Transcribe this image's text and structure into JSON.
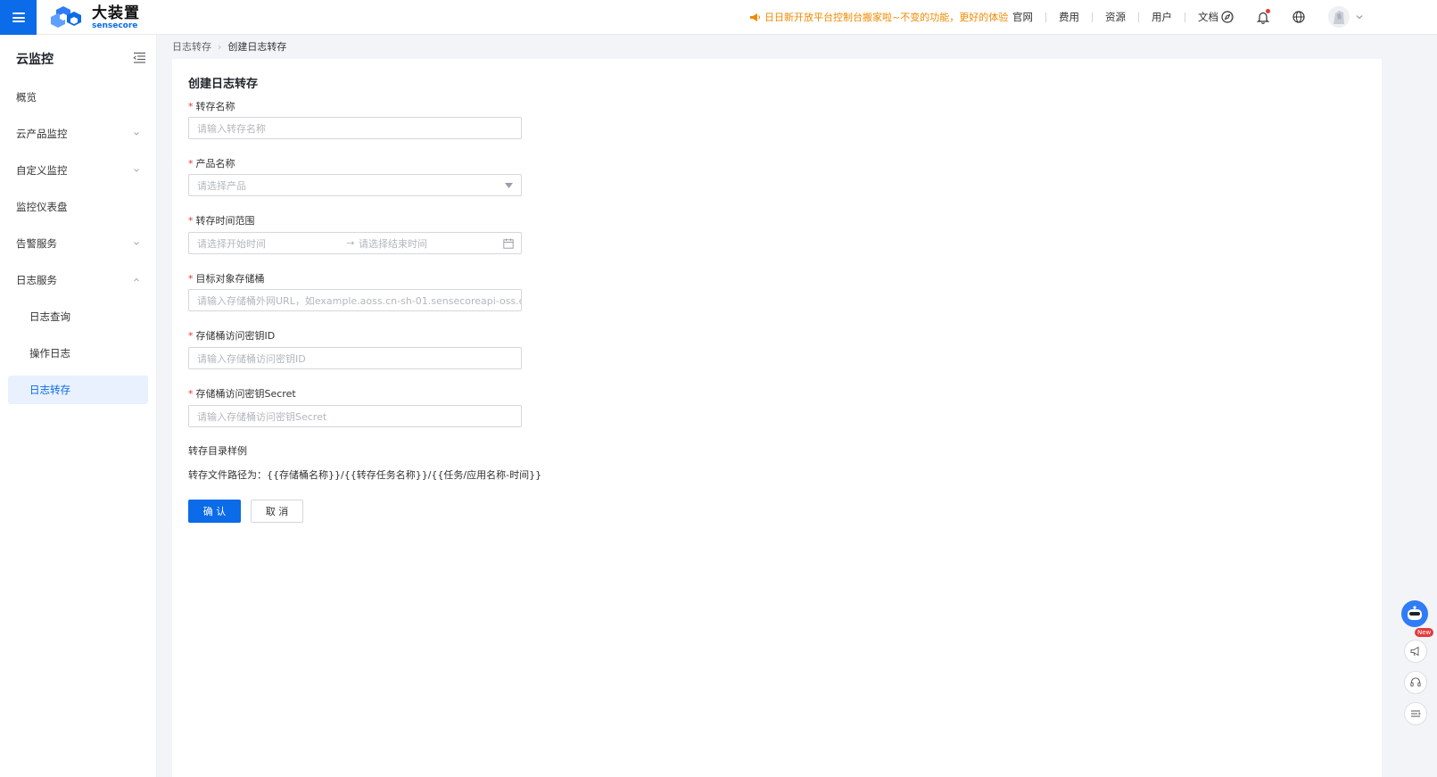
{
  "header": {
    "brand_name": "大装置",
    "brand_sub": "sensecore",
    "notice": "日日新开放平台控制台搬家啦~不变的功能，更好的体验",
    "nav": [
      "官网",
      "费用",
      "资源",
      "用户",
      "文档"
    ],
    "icons": [
      "compass-icon",
      "bell-icon",
      "globe-icon"
    ],
    "accent_color": "#0b6be8",
    "notice_color": "#f08a00"
  },
  "sidebar": {
    "title": "云监控",
    "items": [
      {
        "label": "概览",
        "expandable": false
      },
      {
        "label": "云产品监控",
        "expandable": true,
        "expanded": false
      },
      {
        "label": "自定义监控",
        "expandable": true,
        "expanded": false
      },
      {
        "label": "监控仪表盘",
        "expandable": false
      },
      {
        "label": "告警服务",
        "expandable": true,
        "expanded": false
      },
      {
        "label": "日志服务",
        "expandable": true,
        "expanded": true
      },
      {
        "label": "日志查询",
        "sub": true
      },
      {
        "label": "操作日志",
        "sub": true
      },
      {
        "label": "日志转存",
        "sub": true,
        "active": true
      }
    ]
  },
  "breadcrumb": {
    "parent": "日志转存",
    "current": "创建日志转存"
  },
  "form": {
    "title": "创建日志转存",
    "fields": [
      {
        "label": "转存名称",
        "required": true,
        "placeholder": "请输入转存名称",
        "type": "text"
      },
      {
        "label": "产品名称",
        "required": true,
        "placeholder": "请选择产品",
        "type": "select"
      },
      {
        "label": "转存时间范围",
        "required": true,
        "placeholder_start": "请选择开始时间",
        "placeholder_end": "请选择结束时间",
        "arrow": "→",
        "type": "daterange"
      },
      {
        "label": "目标对象存储桶",
        "required": true,
        "placeholder": "请输入存储桶外网URL，如example.aoss.cn-sh-01.sensecoreapi-oss.cn",
        "type": "text"
      },
      {
        "label": "存储桶访问密钥ID",
        "required": true,
        "placeholder": "请输入存储桶访问密钥ID",
        "type": "text"
      },
      {
        "label": "存储桶访问密钥Secret",
        "required": true,
        "placeholder": "请输入存储桶访问密钥Secret",
        "type": "text"
      }
    ],
    "required_mark": "*",
    "example_title": "转存目录样例",
    "example_path": "转存文件路径为：{{存储桶名称}}/{{转存任务名称}}/{{任务/应用名称-时间}}",
    "confirm_label": "确 认",
    "cancel_label": "取 消"
  },
  "floating_tools": {
    "new_badge": "New",
    "icons": [
      "assistant-bot-icon",
      "announcement-icon",
      "headset-icon",
      "menu-list-icon"
    ]
  }
}
